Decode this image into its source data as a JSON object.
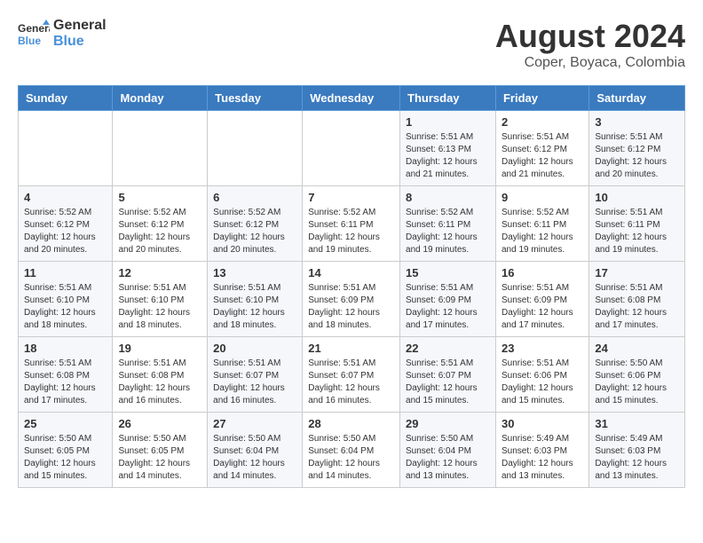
{
  "header": {
    "logo_general": "General",
    "logo_blue": "Blue",
    "month_year": "August 2024",
    "location": "Coper, Boyaca, Colombia"
  },
  "calendar": {
    "days_of_week": [
      "Sunday",
      "Monday",
      "Tuesday",
      "Wednesday",
      "Thursday",
      "Friday",
      "Saturday"
    ],
    "weeks": [
      [
        {
          "day": "",
          "info": ""
        },
        {
          "day": "",
          "info": ""
        },
        {
          "day": "",
          "info": ""
        },
        {
          "day": "",
          "info": ""
        },
        {
          "day": "1",
          "info": "Sunrise: 5:51 AM\nSunset: 6:13 PM\nDaylight: 12 hours\nand 21 minutes."
        },
        {
          "day": "2",
          "info": "Sunrise: 5:51 AM\nSunset: 6:12 PM\nDaylight: 12 hours\nand 21 minutes."
        },
        {
          "day": "3",
          "info": "Sunrise: 5:51 AM\nSunset: 6:12 PM\nDaylight: 12 hours\nand 20 minutes."
        }
      ],
      [
        {
          "day": "4",
          "info": "Sunrise: 5:52 AM\nSunset: 6:12 PM\nDaylight: 12 hours\nand 20 minutes."
        },
        {
          "day": "5",
          "info": "Sunrise: 5:52 AM\nSunset: 6:12 PM\nDaylight: 12 hours\nand 20 minutes."
        },
        {
          "day": "6",
          "info": "Sunrise: 5:52 AM\nSunset: 6:12 PM\nDaylight: 12 hours\nand 20 minutes."
        },
        {
          "day": "7",
          "info": "Sunrise: 5:52 AM\nSunset: 6:11 PM\nDaylight: 12 hours\nand 19 minutes."
        },
        {
          "day": "8",
          "info": "Sunrise: 5:52 AM\nSunset: 6:11 PM\nDaylight: 12 hours\nand 19 minutes."
        },
        {
          "day": "9",
          "info": "Sunrise: 5:52 AM\nSunset: 6:11 PM\nDaylight: 12 hours\nand 19 minutes."
        },
        {
          "day": "10",
          "info": "Sunrise: 5:51 AM\nSunset: 6:11 PM\nDaylight: 12 hours\nand 19 minutes."
        }
      ],
      [
        {
          "day": "11",
          "info": "Sunrise: 5:51 AM\nSunset: 6:10 PM\nDaylight: 12 hours\nand 18 minutes."
        },
        {
          "day": "12",
          "info": "Sunrise: 5:51 AM\nSunset: 6:10 PM\nDaylight: 12 hours\nand 18 minutes."
        },
        {
          "day": "13",
          "info": "Sunrise: 5:51 AM\nSunset: 6:10 PM\nDaylight: 12 hours\nand 18 minutes."
        },
        {
          "day": "14",
          "info": "Sunrise: 5:51 AM\nSunset: 6:09 PM\nDaylight: 12 hours\nand 18 minutes."
        },
        {
          "day": "15",
          "info": "Sunrise: 5:51 AM\nSunset: 6:09 PM\nDaylight: 12 hours\nand 17 minutes."
        },
        {
          "day": "16",
          "info": "Sunrise: 5:51 AM\nSunset: 6:09 PM\nDaylight: 12 hours\nand 17 minutes."
        },
        {
          "day": "17",
          "info": "Sunrise: 5:51 AM\nSunset: 6:08 PM\nDaylight: 12 hours\nand 17 minutes."
        }
      ],
      [
        {
          "day": "18",
          "info": "Sunrise: 5:51 AM\nSunset: 6:08 PM\nDaylight: 12 hours\nand 17 minutes."
        },
        {
          "day": "19",
          "info": "Sunrise: 5:51 AM\nSunset: 6:08 PM\nDaylight: 12 hours\nand 16 minutes."
        },
        {
          "day": "20",
          "info": "Sunrise: 5:51 AM\nSunset: 6:07 PM\nDaylight: 12 hours\nand 16 minutes."
        },
        {
          "day": "21",
          "info": "Sunrise: 5:51 AM\nSunset: 6:07 PM\nDaylight: 12 hours\nand 16 minutes."
        },
        {
          "day": "22",
          "info": "Sunrise: 5:51 AM\nSunset: 6:07 PM\nDaylight: 12 hours\nand 15 minutes."
        },
        {
          "day": "23",
          "info": "Sunrise: 5:51 AM\nSunset: 6:06 PM\nDaylight: 12 hours\nand 15 minutes."
        },
        {
          "day": "24",
          "info": "Sunrise: 5:50 AM\nSunset: 6:06 PM\nDaylight: 12 hours\nand 15 minutes."
        }
      ],
      [
        {
          "day": "25",
          "info": "Sunrise: 5:50 AM\nSunset: 6:05 PM\nDaylight: 12 hours\nand 15 minutes."
        },
        {
          "day": "26",
          "info": "Sunrise: 5:50 AM\nSunset: 6:05 PM\nDaylight: 12 hours\nand 14 minutes."
        },
        {
          "day": "27",
          "info": "Sunrise: 5:50 AM\nSunset: 6:04 PM\nDaylight: 12 hours\nand 14 minutes."
        },
        {
          "day": "28",
          "info": "Sunrise: 5:50 AM\nSunset: 6:04 PM\nDaylight: 12 hours\nand 14 minutes."
        },
        {
          "day": "29",
          "info": "Sunrise: 5:50 AM\nSunset: 6:04 PM\nDaylight: 12 hours\nand 13 minutes."
        },
        {
          "day": "30",
          "info": "Sunrise: 5:49 AM\nSunset: 6:03 PM\nDaylight: 12 hours\nand 13 minutes."
        },
        {
          "day": "31",
          "info": "Sunrise: 5:49 AM\nSunset: 6:03 PM\nDaylight: 12 hours\nand 13 minutes."
        }
      ]
    ]
  }
}
